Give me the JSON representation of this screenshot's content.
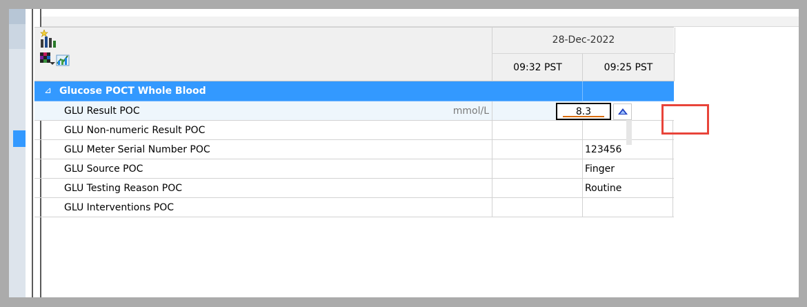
{
  "header": {
    "date": "28-Dec-2022",
    "times": [
      "09:32 PST",
      "09:25 PST"
    ]
  },
  "icons": [
    "bar-chart-sparkle-icon",
    "color-grid-chart-icon"
  ],
  "group": {
    "collapse_glyph": "⊿",
    "label": "Glucose POCT Whole Blood"
  },
  "rows": [
    {
      "label": "GLU Result POC",
      "unit": "mmol/L",
      "col1": "",
      "col2": "8.3"
    },
    {
      "label": "GLU Non-numeric Result POC",
      "col1": "",
      "col2": ""
    },
    {
      "label": "GLU Meter Serial Number POC",
      "col1": "",
      "col2": "123456"
    },
    {
      "label": "GLU Source POC",
      "col1": "",
      "col2": "Finger"
    },
    {
      "label": "GLU Testing Reason POC",
      "col1": "",
      "col2": "Routine"
    },
    {
      "label": "GLU Interventions POC",
      "col1": "",
      "col2": ""
    }
  ],
  "colors": {
    "group_bg": "#3399ff",
    "highlight_box": "#e8443a",
    "frame_bg": "#ababab"
  }
}
